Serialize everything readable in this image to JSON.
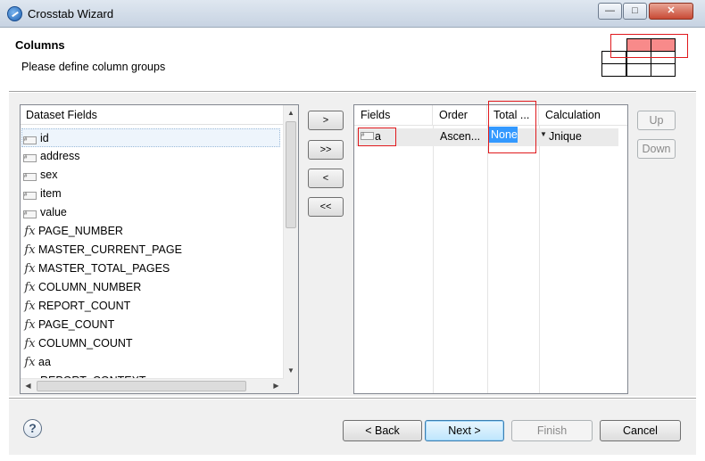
{
  "window": {
    "title": "Crosstab Wizard",
    "controls": {
      "minimize": "—",
      "maximize": "□",
      "close": "✕"
    }
  },
  "header": {
    "title": "Columns",
    "description": "Please define column groups"
  },
  "dataset_fields": {
    "header": "Dataset Fields",
    "items": [
      {
        "label": "id",
        "icon": "field-icon",
        "selected": true
      },
      {
        "label": "address",
        "icon": "field-icon"
      },
      {
        "label": "sex",
        "icon": "field-icon"
      },
      {
        "label": "item",
        "icon": "field-icon"
      },
      {
        "label": "value",
        "icon": "field-icon"
      },
      {
        "label": "PAGE_NUMBER",
        "icon": "fx-icon"
      },
      {
        "label": "MASTER_CURRENT_PAGE",
        "icon": "fx-icon"
      },
      {
        "label": "MASTER_TOTAL_PAGES",
        "icon": "fx-icon"
      },
      {
        "label": "COLUMN_NUMBER",
        "icon": "fx-icon"
      },
      {
        "label": "REPORT_COUNT",
        "icon": "fx-icon"
      },
      {
        "label": "PAGE_COUNT",
        "icon": "fx-icon"
      },
      {
        "label": "COLUMN_COUNT",
        "icon": "fx-icon"
      },
      {
        "label": "aa",
        "icon": "fx-icon"
      },
      {
        "label": "REPORT_CONTEXT",
        "icon": "field-icon"
      }
    ]
  },
  "transfer_buttons": {
    "add": ">",
    "add_all": ">>",
    "remove": "<",
    "remove_all": "<<"
  },
  "columns_table": {
    "headers": {
      "fields": "Fields",
      "order": "Order",
      "total": "Total ...",
      "calculation": "Calculation"
    },
    "rows": [
      {
        "field": "a",
        "order": "Ascen...",
        "total": "None",
        "calculation": "Jnique"
      }
    ]
  },
  "order_buttons": {
    "up": "Up",
    "down": "Down"
  },
  "footer": {
    "help": "?",
    "back": "< Back",
    "next": "Next >",
    "finish": "Finish",
    "cancel": "Cancel"
  },
  "colors": {
    "highlight_red": "#e0191d",
    "group_fill": "#f88a8a",
    "selection": "#3399ff"
  }
}
